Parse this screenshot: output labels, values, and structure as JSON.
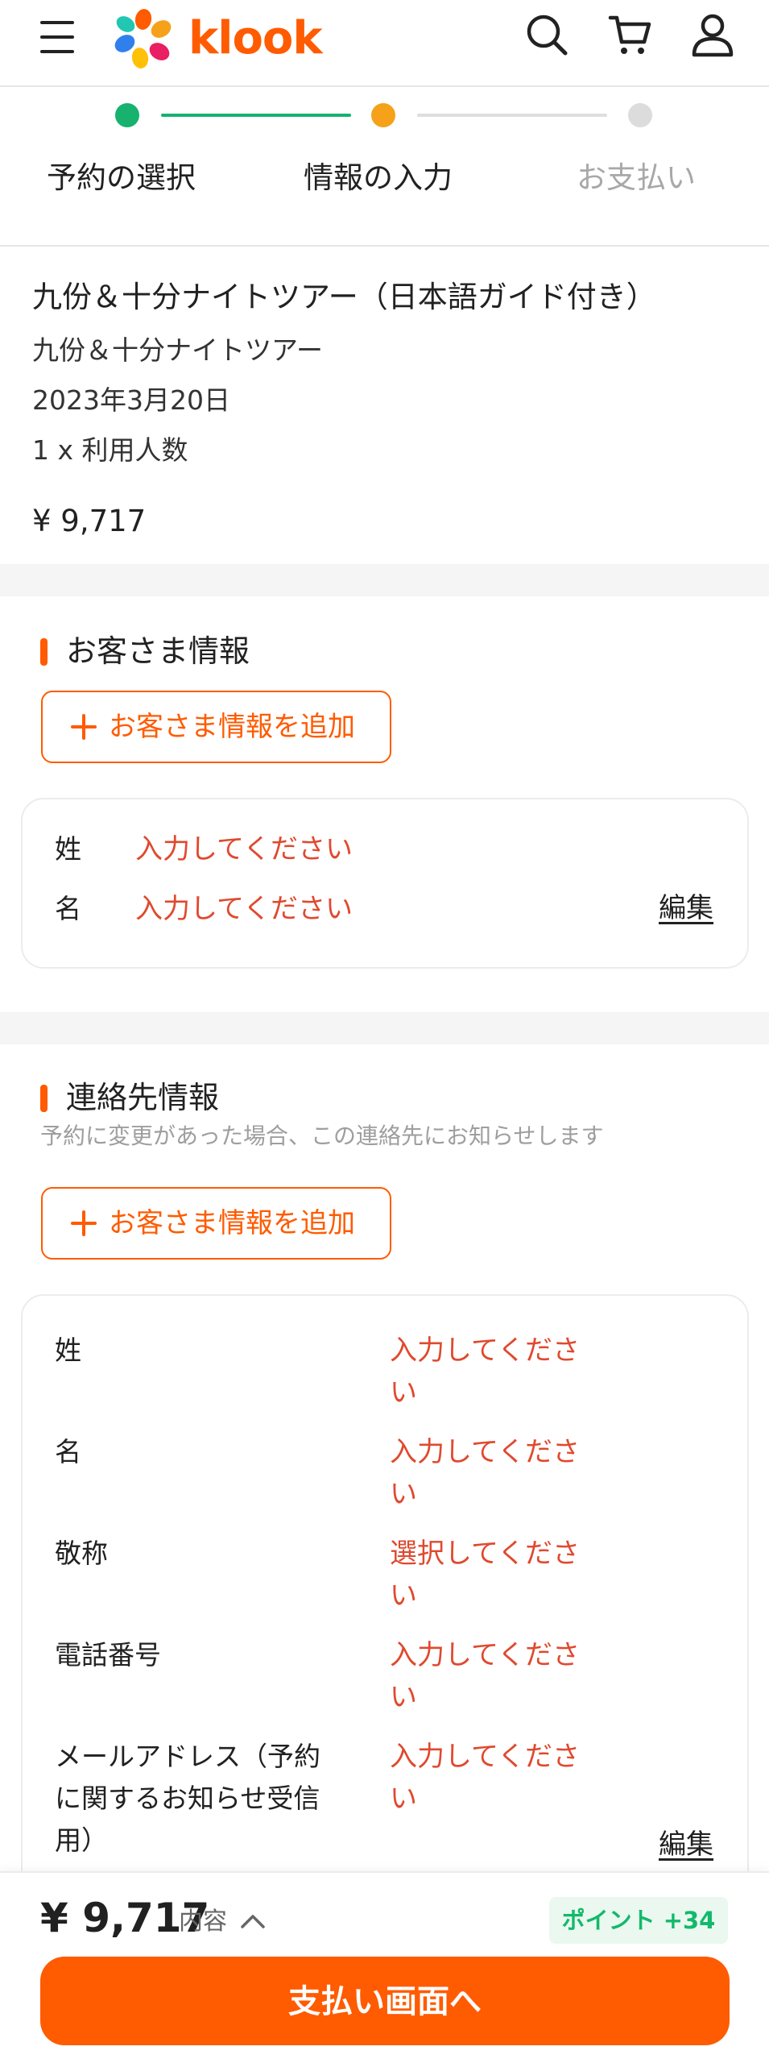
{
  "brand": {
    "name": "klook",
    "color": "#ff5b00"
  },
  "icons": {
    "menu": "hamburger-menu-icon",
    "search": "search-icon",
    "cart": "cart-icon",
    "account": "user-icon",
    "add": "plus-icon",
    "details": "chevron-up-icon"
  },
  "steps": [
    {
      "label": "予約の選択",
      "state": "done",
      "color": "#16b26e"
    },
    {
      "label": "情報の入力",
      "state": "current",
      "color": "#f5a11a"
    },
    {
      "label": "お支払い",
      "state": "upcoming",
      "color": "#d9d9d9"
    }
  ],
  "booking": {
    "title": "九份＆十分ナイトツアー（日本語ガイド付き）",
    "package": "九份＆十分ナイトツアー",
    "date": "2023年3月20日",
    "quantity": "1 x 利用人数",
    "price": "¥ 9,717"
  },
  "traveler": {
    "title": "お客さま情報",
    "add_button": "お客さま情報を追加",
    "fields": [
      {
        "label": "姓",
        "value": "入力してください"
      },
      {
        "label": "名",
        "value": "入力してください"
      }
    ],
    "edit": "編集"
  },
  "contact": {
    "title": "連絡先情報",
    "hint": "予約に変更があった場合、この連絡先にお知らせします",
    "add_button": "お客さま情報を追加",
    "fields": [
      {
        "label": "姓",
        "value": "入力してください"
      },
      {
        "label": "名",
        "value": "入力してください"
      },
      {
        "label": "敬称",
        "value": "選択してください"
      },
      {
        "label": "電話番号",
        "value": "入力してください"
      },
      {
        "label": "メールアドレス（予約に関するお知らせ受信用）",
        "value": "入力してください"
      }
    ],
    "edit": "編集"
  },
  "footer": {
    "total": "¥ 9,717",
    "details_label": "内容",
    "points": "ポイント +34",
    "pay_button": "支払い画面へ"
  },
  "colors": {
    "accent": "#ff5b00",
    "placeholder_text": "#e0492e",
    "points_text": "#13b96b",
    "step_done": "#16b26e",
    "step_current": "#f5a11a",
    "step_upcoming": "#d9d9d9"
  }
}
